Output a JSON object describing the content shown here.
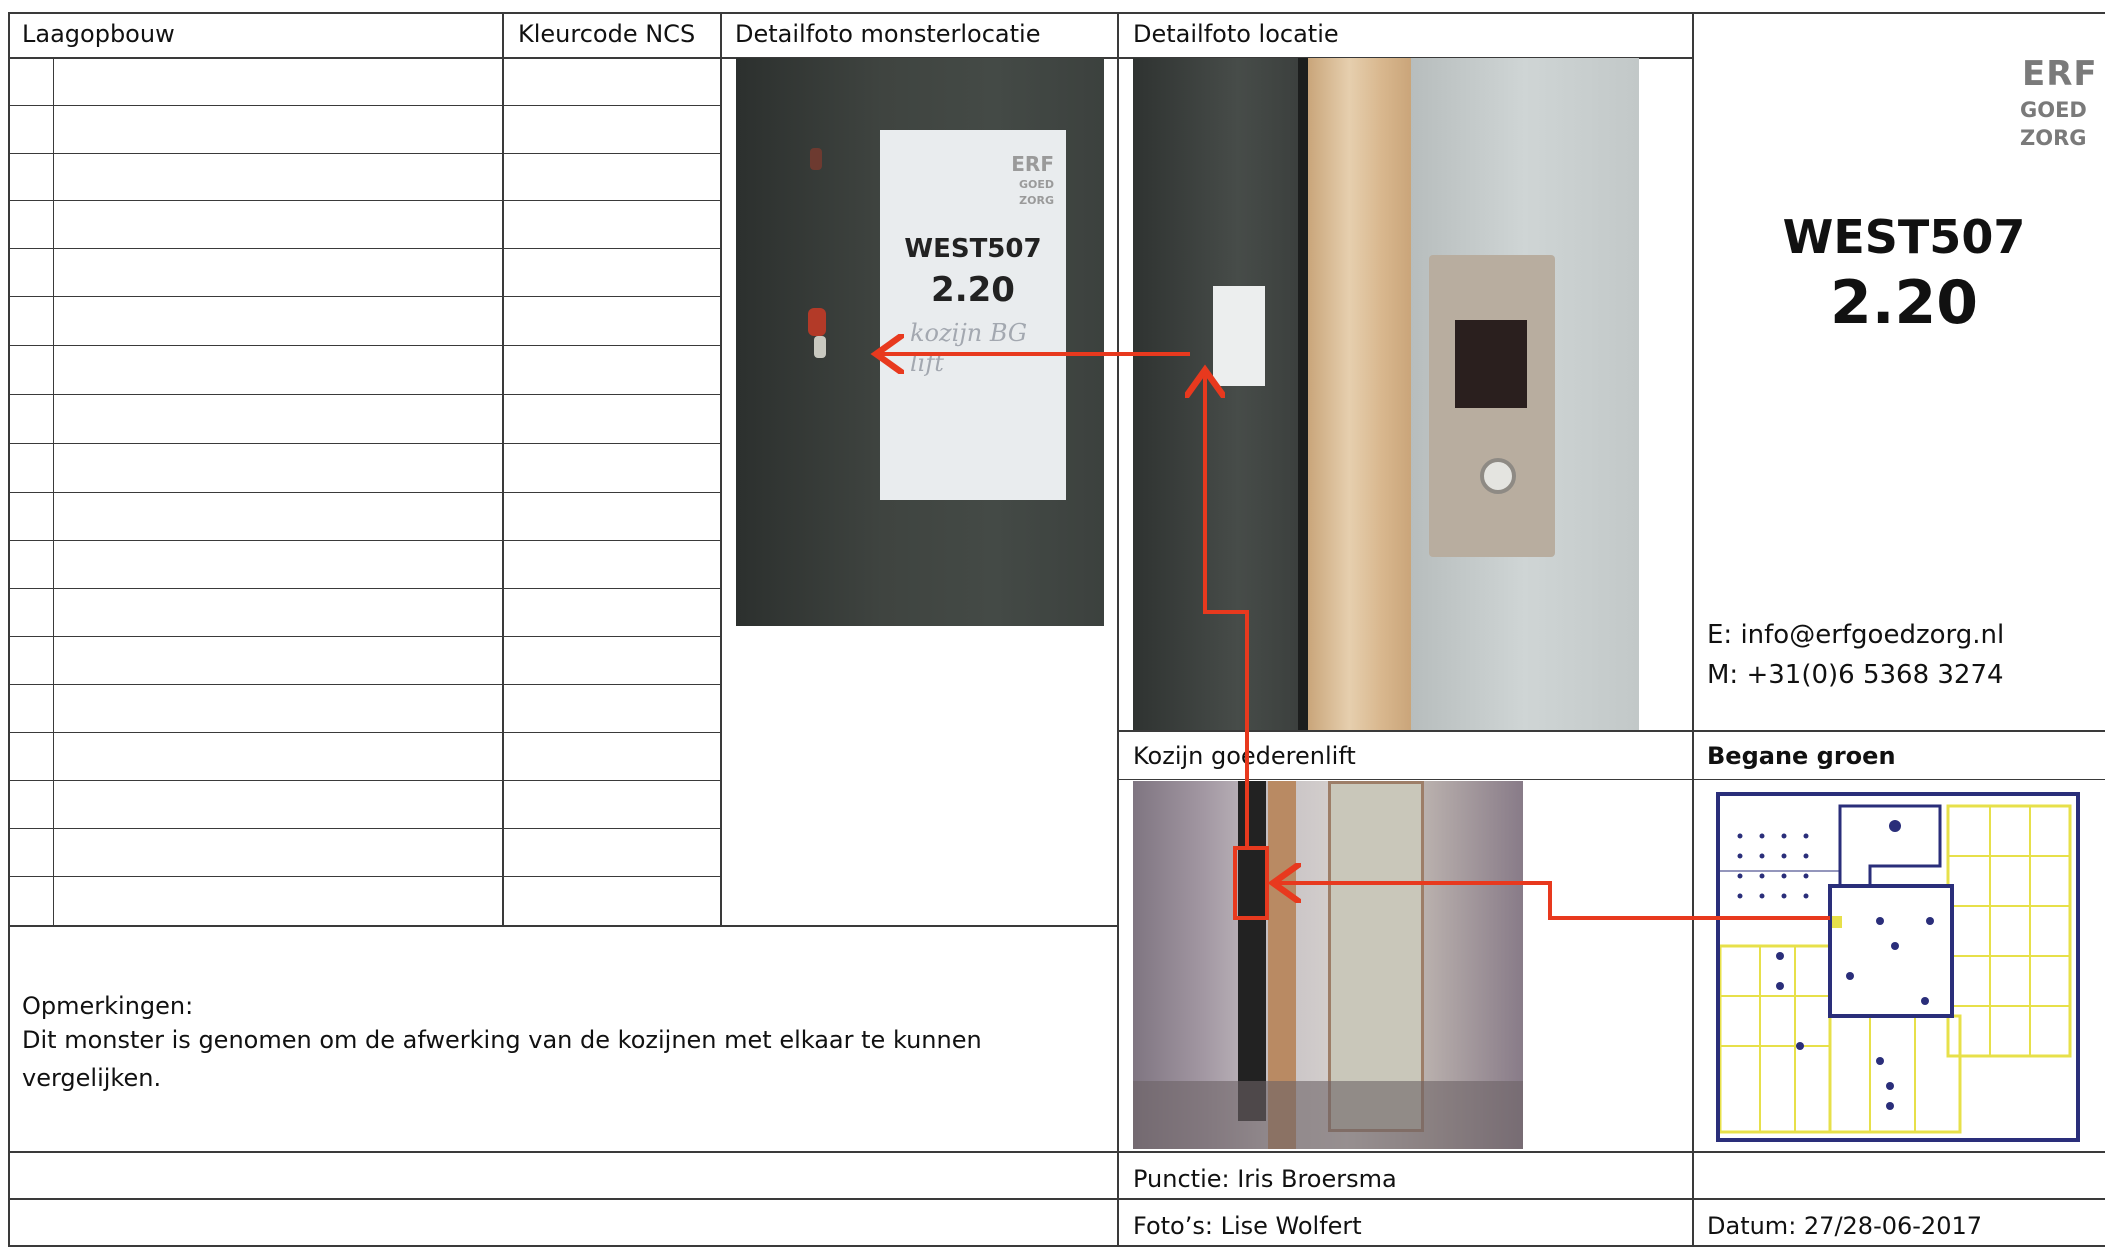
{
  "headers": {
    "laagopbouw": "Laagopbouw",
    "kleurcode": "Kleurcode NCS",
    "detail_monster": "Detailfoto monsterlocatie",
    "detail_locatie": "Detailfoto locatie"
  },
  "logo": {
    "line1": "ERF",
    "line2": "GOED",
    "line3": "ZORG"
  },
  "sample": {
    "code": "WEST507",
    "number": "2.20",
    "note": "kozijn BG lift"
  },
  "contact": {
    "email": "E: info@erfgoedzorg.nl",
    "mobile": "M: +31(0)6 5368 3274"
  },
  "sections": {
    "kozijn": "Kozijn goederenlift",
    "begane_groen": "Begane groen"
  },
  "remarks": {
    "title": "Opmerkingen:",
    "line1": "Dit monster is genomen om de afwerking van de kozijnen met elkaar te kunnen",
    "line2": "vergelijken."
  },
  "footer": {
    "punctie": "Punctie: Iris Broersma",
    "fotos": "Foto’s: Lise Wolfert",
    "datum": "Datum: 27/28-06-2017"
  },
  "colors": {
    "arrow": "#e8391e",
    "plan_blue": "#2a2e7a",
    "plan_yellow": "#e7e04a"
  }
}
